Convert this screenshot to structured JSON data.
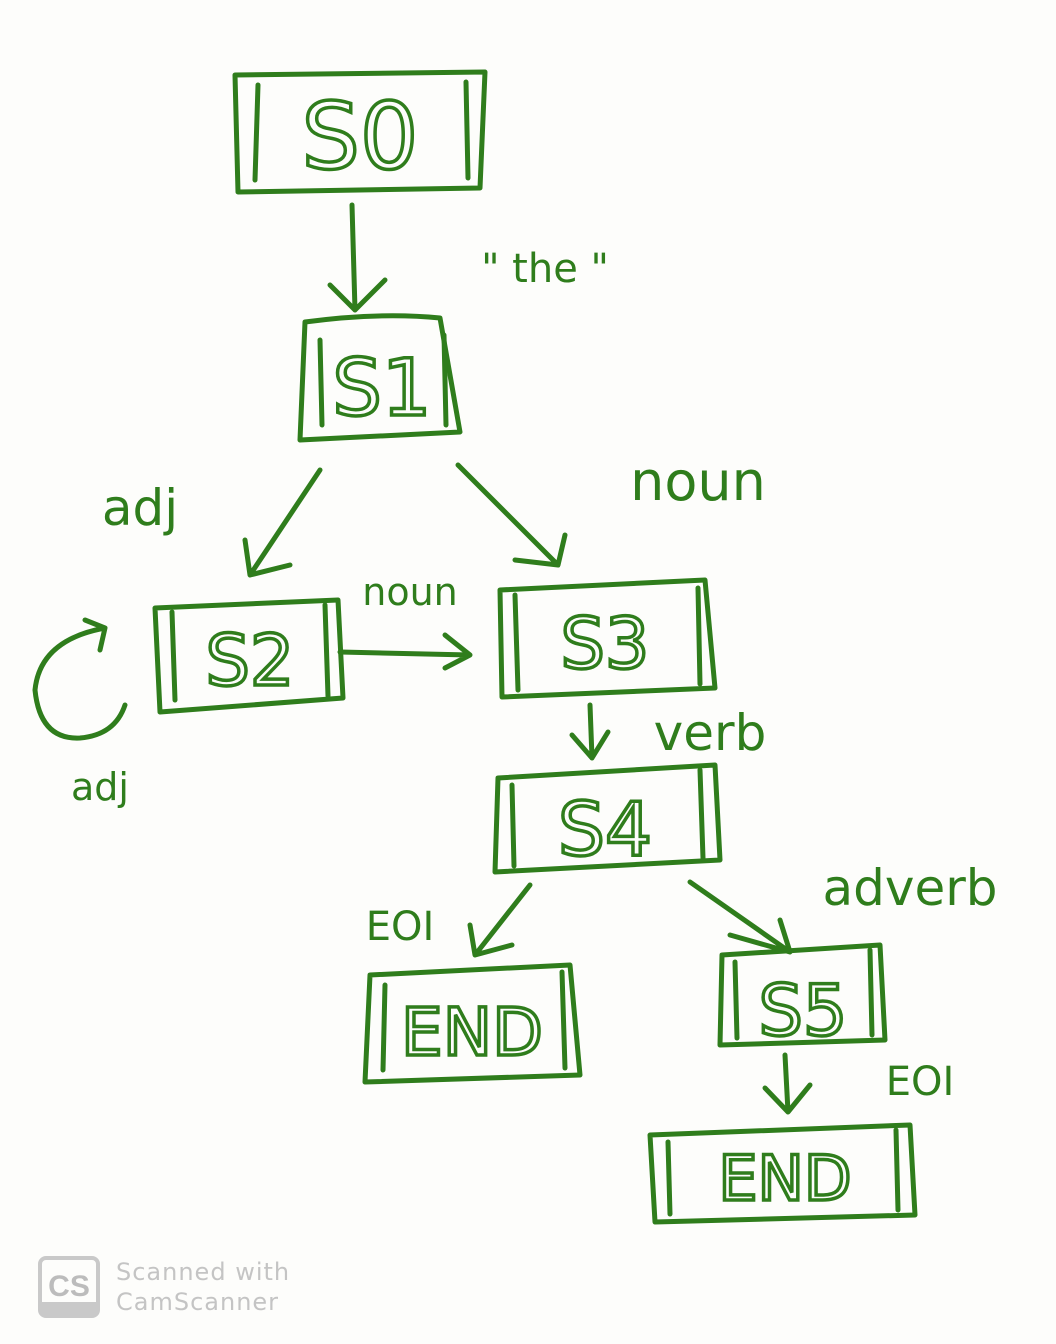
{
  "diagram": {
    "ink_color": "#2f7d1c",
    "nodes": [
      {
        "id": "S0",
        "label": "S0"
      },
      {
        "id": "S1",
        "label": "S1"
      },
      {
        "id": "S2",
        "label": "S2"
      },
      {
        "id": "S3",
        "label": "S3"
      },
      {
        "id": "S4",
        "label": "S4"
      },
      {
        "id": "END1",
        "label": "END"
      },
      {
        "id": "S5",
        "label": "S5"
      },
      {
        "id": "END2",
        "label": "END"
      }
    ],
    "edges": [
      {
        "from": "S0",
        "to": "S1",
        "label": "\" the \""
      },
      {
        "from": "S1",
        "to": "S2",
        "label": "adj"
      },
      {
        "from": "S1",
        "to": "S3",
        "label": "noun"
      },
      {
        "from": "S2",
        "to": "S2",
        "label": "adj"
      },
      {
        "from": "S2",
        "to": "S3",
        "label": "noun"
      },
      {
        "from": "S3",
        "to": "S4",
        "label": "verb"
      },
      {
        "from": "S4",
        "to": "END1",
        "label": "EOI"
      },
      {
        "from": "S4",
        "to": "S5",
        "label": "adverb"
      },
      {
        "from": "S5",
        "to": "END2",
        "label": "EOI"
      }
    ]
  },
  "watermark": {
    "logo": "CS",
    "line1": "Scanned with",
    "line2": "CamScanner"
  }
}
